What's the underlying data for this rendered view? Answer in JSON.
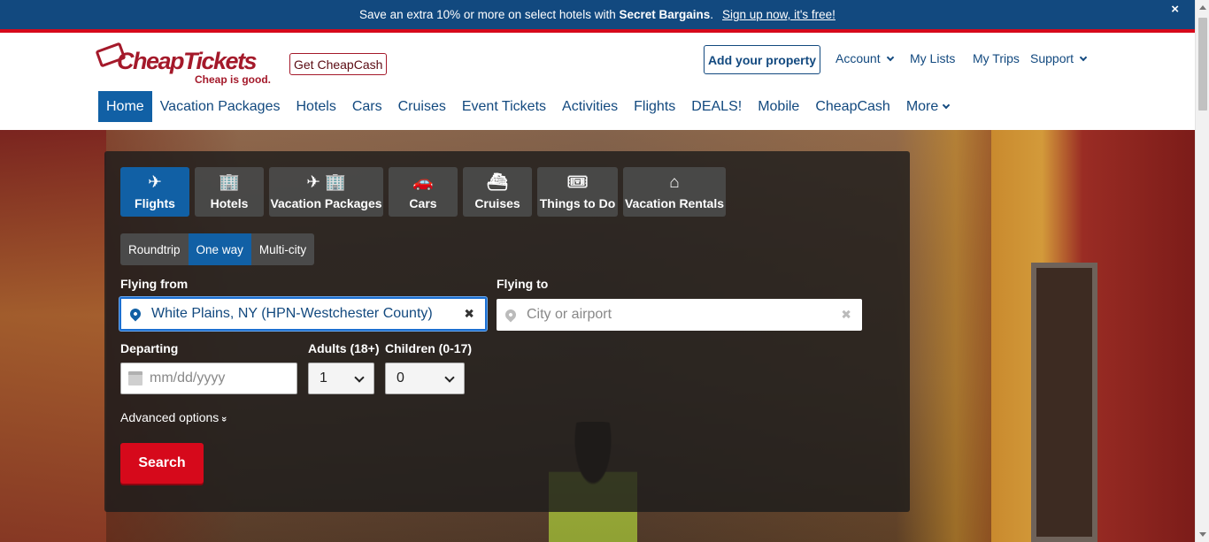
{
  "promo": {
    "text_before": "Save an extra 10% or more on select hotels with ",
    "text_bold": "Secret Bargains",
    "text_after": ".",
    "link": "Sign up now, it's free!",
    "close": "×"
  },
  "header": {
    "logo_name": "CheapTickets",
    "logo_slogan": "Cheap is good.",
    "logo_reg": "®",
    "get_cheapcash": "Get CheapCash",
    "add_property": "Add your property",
    "account": "Account",
    "my_lists": "My Lists",
    "my_trips": "My Trips",
    "support": "Support"
  },
  "nav": {
    "items": [
      "Home",
      "Vacation Packages",
      "Hotels",
      "Cars",
      "Cruises",
      "Event Tickets",
      "Activities",
      "Flights",
      "DEALS!",
      "Mobile",
      "CheapCash",
      "More"
    ]
  },
  "search": {
    "tabs": [
      {
        "label": "Flights",
        "icon": "airplane-icon",
        "glyph": "✈"
      },
      {
        "label": "Hotels",
        "icon": "hotel-icon",
        "glyph": "🏢"
      },
      {
        "label": "Vacation Packages",
        "icon": "package-icon",
        "glyph": "✈ 🏢"
      },
      {
        "label": "Cars",
        "icon": "car-icon",
        "glyph": "🚗"
      },
      {
        "label": "Cruises",
        "icon": "ship-icon",
        "glyph": "⛴"
      },
      {
        "label": "Things to Do",
        "icon": "ticket-icon",
        "glyph": "🎟"
      },
      {
        "label": "Vacation Rentals",
        "icon": "house-icon",
        "glyph": "⌂"
      }
    ],
    "trip_types": [
      "Roundtrip",
      "One way",
      "Multi-city"
    ],
    "flying_from_label": "Flying from",
    "flying_from_value": "White Plains, NY (HPN-Westchester County)",
    "flying_to_label": "Flying to",
    "flying_to_placeholder": "City or airport",
    "departing_label": "Departing",
    "departing_placeholder": "mm/dd/yyyy",
    "adults_label": "Adults (18+)",
    "adults_value": "1",
    "children_label": "Children (0-17)",
    "children_value": "0",
    "advanced": "Advanced options",
    "advanced_glyph": "»",
    "search_button": "Search",
    "clear_glyph": "✖"
  },
  "colors": {
    "brand_red": "#a4192a",
    "nav_blue": "#1160a5",
    "link_blue": "#12497f",
    "search_red": "#d6091b"
  }
}
